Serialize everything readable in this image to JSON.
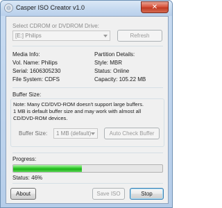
{
  "window": {
    "title": "Casper ISO Creator v1.0",
    "close_glyph": "✕"
  },
  "drive": {
    "label": "Select CDROM or DVDROM Drive:",
    "selected": "[E:] Philips",
    "refresh_label": "Refresh"
  },
  "media_info": {
    "heading": "Media Info:",
    "vol_name": "Vol. Name: Philips",
    "serial": "Serial: 1606305230",
    "file_system": "File System: CDFS"
  },
  "partition": {
    "heading": "Partition Details:",
    "style": "Style: MBR",
    "status": "Status: Online",
    "capacity": "Capacity: 105.22 MB"
  },
  "buffer": {
    "heading": "Buffer Size:",
    "note_line1": "Note: Many CD/DVD-ROM doesn't support large buffers.",
    "note_line2": "1 MB is default buffer size and may work with almost all",
    "note_line3": "CD/DVD-ROM devices.",
    "size_label": "Buffer Size:",
    "size_value": "1 MB (default)",
    "auto_check_label": "Auto Check Buffer"
  },
  "progress": {
    "heading": "Progress:",
    "percent": 46,
    "status_text": "Status: 46%"
  },
  "footer": {
    "about_label": "About",
    "save_label": "Save ISO",
    "stop_label": "Stop"
  },
  "colors": {
    "accent": "#3fd23a",
    "close": "#c23b23"
  }
}
